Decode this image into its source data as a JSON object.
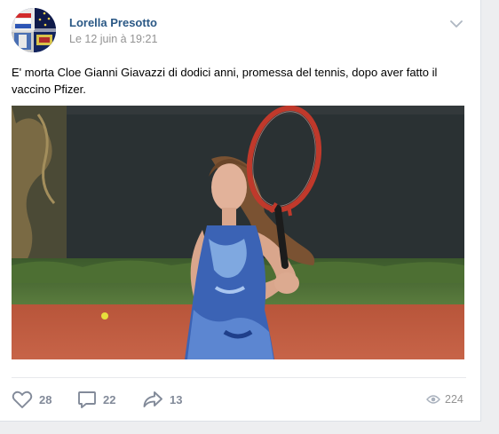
{
  "post": {
    "author": "Lorella Presotto",
    "timestamp": "Le 12 juin à 19:21",
    "text": "E' morta Cloe Gianni Giavazzi di dodici anni, promessa del tennis, dopo aver fatto il vaccino Pfizer.",
    "image_icon": "photo-of-young-tennis-player-on-clay-court"
  },
  "actions": {
    "likes": {
      "icon": "heart-icon",
      "count": "28"
    },
    "comments": {
      "icon": "comment-icon",
      "count": "22"
    },
    "shares": {
      "icon": "share-icon",
      "count": "13"
    },
    "views": {
      "icon": "eye-icon",
      "count": "224"
    }
  },
  "colors": {
    "author_link": "#2a5885",
    "muted_text": "#939393",
    "action_gray": "#828a99",
    "page_background": "#edeef0"
  }
}
